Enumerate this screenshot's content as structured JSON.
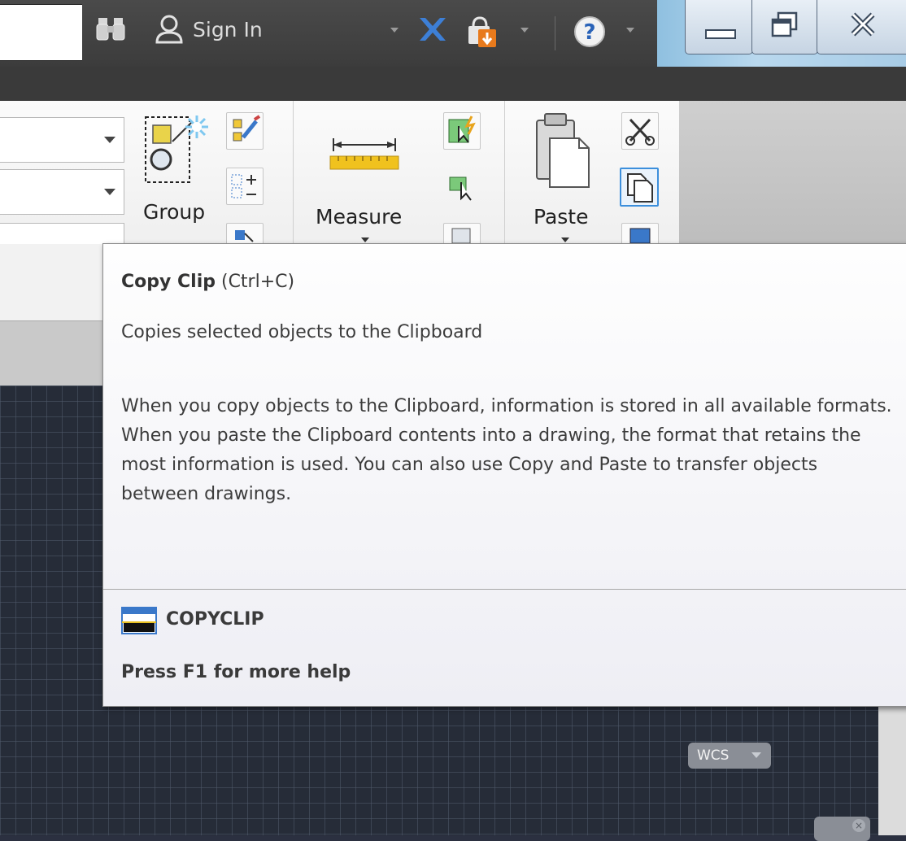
{
  "titlebar": {
    "user_label": "Sign In"
  },
  "ribbon": {
    "group_label": "Group",
    "measure_label": "Measure",
    "paste_label": "Paste"
  },
  "tooltip": {
    "title": "Copy Clip",
    "shortcut": "(Ctrl+C)",
    "description": "Copies selected objects to the Clipboard",
    "body": "When you copy objects to the Clipboard, information is stored in all available formats. When you paste the Clipboard contents into a drawing, the format that retains the most information is used. You can also use Copy and Paste to transfer objects between drawings.",
    "command": "COPYCLIP",
    "help": "Press F1 for more help"
  },
  "viewport": {
    "ucs_label": "WCS"
  },
  "colors": {
    "accent": "#3c8fdc",
    "drawing_bg": "#262c38",
    "tooltip_bg": "#f4f4f8"
  }
}
